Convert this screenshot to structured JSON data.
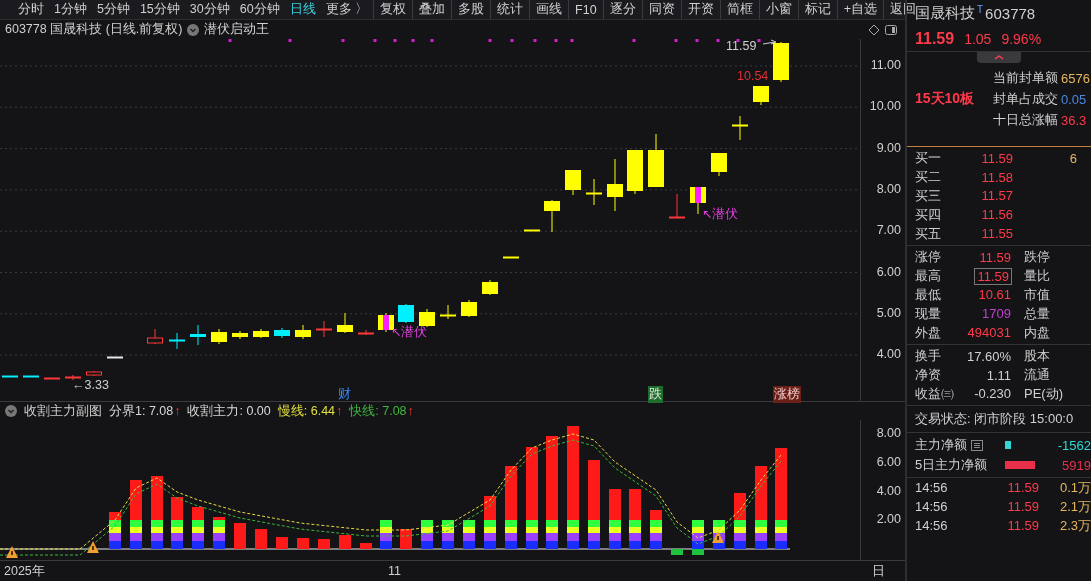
{
  "toolbar": {
    "tabs": [
      {
        "label": "分时",
        "selected": false
      },
      {
        "label": "1分钟",
        "selected": false
      },
      {
        "label": "5分钟",
        "selected": false
      },
      {
        "label": "15分钟",
        "selected": false
      },
      {
        "label": "30分钟",
        "selected": false
      },
      {
        "label": "60分钟",
        "selected": false
      },
      {
        "label": "日线",
        "selected": true
      },
      {
        "label": "更多 〉",
        "selected": false
      }
    ],
    "buttons": [
      "复权",
      "叠加",
      "多股",
      "统计",
      "画线",
      "F10",
      "逐分",
      "同资",
      "开资",
      "简框",
      "小窗",
      "标记",
      "+自选",
      "返回"
    ]
  },
  "chart_header": {
    "title": "603778 国晟科技 (日线.前复权)",
    "indicator": "潜伏启动王"
  },
  "price_axis": [
    "11.00",
    "10.00",
    "9.00",
    "8.00",
    "7.00",
    "6.00",
    "5.00",
    "4.00"
  ],
  "price_marks": [
    {
      "text": "11.59",
      "kind": "high"
    },
    {
      "text": "10.54",
      "kind": "close"
    },
    {
      "text": "←3.33",
      "kind": "low"
    }
  ],
  "signals": [
    {
      "text": "↖潜伏"
    },
    {
      "text": "↖潜伏"
    }
  ],
  "events": [
    {
      "text": "财",
      "kind": "finance"
    },
    {
      "text": "跌",
      "kind": "fall"
    },
    {
      "text": "涨榜",
      "kind": "rise"
    }
  ],
  "sub_chart": {
    "title": "收割主力副图",
    "values": [
      {
        "label": "分界1: 7.08",
        "arrow": "↑",
        "color": "#d8d8d8"
      },
      {
        "label": "收割主力: 0.00",
        "color": "#d8d8d8"
      },
      {
        "label": "慢线: 6.44",
        "arrow": "↑",
        "color": "#e0e040"
      },
      {
        "label": "快线: 7.08",
        "arrow": "↑",
        "color": "#3cb83c"
      }
    ],
    "axis": [
      "8.00",
      "6.00",
      "4.00",
      "2.00"
    ]
  },
  "x_axis": [
    "2025年",
    "11",
    "日"
  ],
  "quote": {
    "name": "国晟科技",
    "badge": "T",
    "code": "603778",
    "price": "11.59",
    "change": "1.05",
    "change_pct": "9.96%",
    "limit_streak": "15天10板",
    "limit_rows": [
      {
        "label": "当前封单额",
        "value": "6576",
        "kind": "amount"
      },
      {
        "label": "封单占成交",
        "value": "0.05",
        "kind": "ratio"
      },
      {
        "label": "十日总涨幅",
        "value": "36.3",
        "kind": "up"
      }
    ],
    "bids": [
      {
        "label": "买一",
        "price": "11.59",
        "volume": "6"
      },
      {
        "label": "买二",
        "price": "11.58"
      },
      {
        "label": "买三",
        "price": "11.57"
      },
      {
        "label": "买四",
        "price": "11.56"
      },
      {
        "label": "买五",
        "price": "11.55"
      }
    ],
    "stats": [
      {
        "label": "涨停",
        "value": "11.59",
        "kind": "up",
        "highlighted": false,
        "label2": "跌停"
      },
      {
        "label": "最高",
        "value": "11.59",
        "kind": "up",
        "highlighted": true,
        "label2": "量比"
      },
      {
        "label": "最低",
        "value": "10.61",
        "kind": "up",
        "highlighted": false,
        "label2": "市值"
      },
      {
        "label": "现量",
        "value": "1709",
        "kind": "volume",
        "highlighted": false,
        "label2": "总量"
      },
      {
        "label": "外盘",
        "value": "494031",
        "kind": "up",
        "highlighted": false,
        "label2": "内盘"
      }
    ],
    "finance": [
      {
        "label": "换手",
        "value": "17.60%",
        "kind": "plain",
        "highlighted": false,
        "label2": "股本"
      },
      {
        "label": "净资",
        "value": "1.11",
        "kind": "plain",
        "highlighted": false,
        "label2": "流通"
      },
      {
        "label": "收益㈢",
        "value": "-0.230",
        "kind": "plain",
        "highlighted": false,
        "label2": "PE(动)"
      }
    ],
    "status": "交易状态: 闭市阶段 15:00:0",
    "flows": [
      {
        "label": "主力净额",
        "has_menu": true,
        "kind": "dot",
        "value": "-1562",
        "color": "#30d8d8"
      },
      {
        "label": "5日主力净额",
        "has_menu": false,
        "kind": "bar",
        "value": "5919",
        "color": "#e8304a"
      }
    ],
    "ticks": [
      {
        "time": "14:56",
        "price": "11.59",
        "volume": "0.1万"
      },
      {
        "time": "14:56",
        "price": "11.59",
        "volume": "2.1万"
      },
      {
        "time": "14:56",
        "price": "11.59",
        "volume": "2.3万"
      }
    ]
  }
}
